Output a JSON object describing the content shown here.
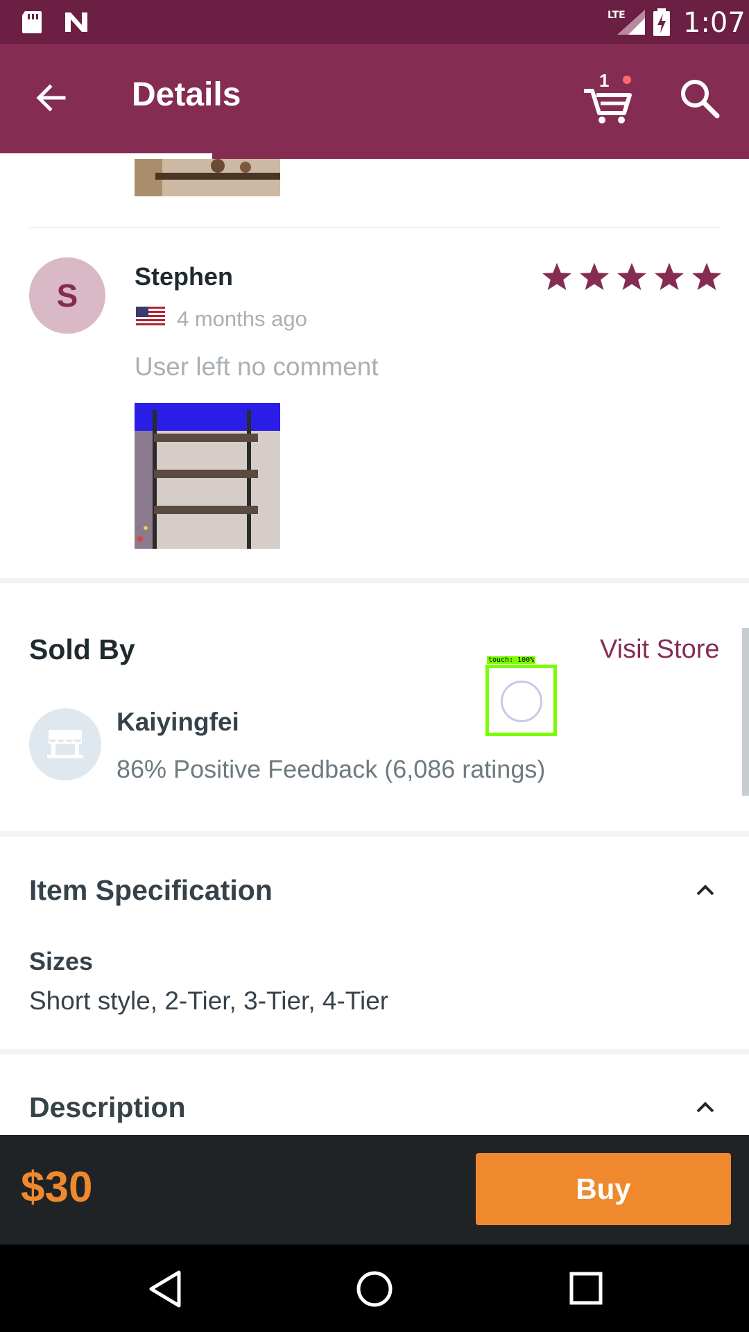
{
  "status_bar": {
    "clock": "1:07",
    "network": "LTE"
  },
  "app_bar": {
    "title": "Details",
    "cart_count": "1",
    "accent_color": "#852c52"
  },
  "review": {
    "avatar_letter": "S",
    "name": "Stephen",
    "time": "4 months ago",
    "comment": "User left no comment",
    "rating": 5,
    "flag": "us-flag-icon"
  },
  "seller": {
    "section_title": "Sold By",
    "visit_store_label": "Visit Store",
    "name": "Kaiyingfei",
    "feedback": "86% Positive Feedback (6,086 ratings)"
  },
  "touch_marker": {
    "label": "touch: 100%"
  },
  "item_specification": {
    "title": "Item Specification",
    "sizes_label": "Sizes",
    "sizes_value": "Short style, 2-Tier, 3-Tier, 4-Tier"
  },
  "description": {
    "title": "Description"
  },
  "buy_bar": {
    "price": "$30",
    "buy_label": "Buy",
    "price_color": "#f0892d"
  }
}
